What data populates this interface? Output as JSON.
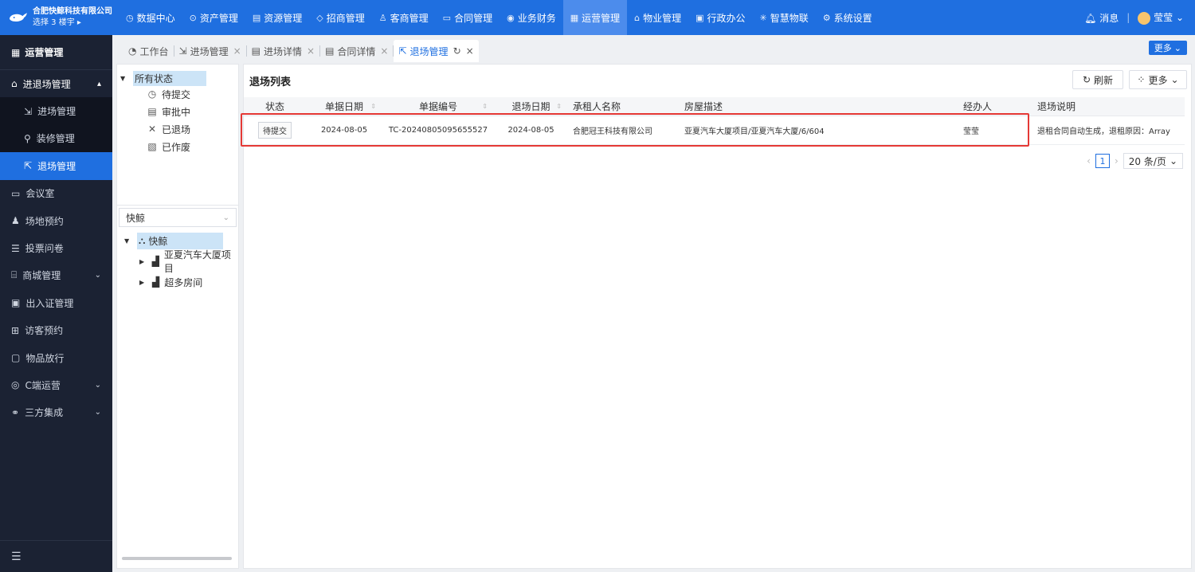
{
  "brand": {
    "name": "合肥快鲸科技有限公司",
    "sub": "选择 3 楼宇 ▸"
  },
  "nav": [
    {
      "label": "数据中心",
      "icon": "◷"
    },
    {
      "label": "资产管理",
      "icon": "⊙"
    },
    {
      "label": "资源管理",
      "icon": "▤"
    },
    {
      "label": "招商管理",
      "icon": "◇"
    },
    {
      "label": "客商管理",
      "icon": "♙"
    },
    {
      "label": "合同管理",
      "icon": "▭"
    },
    {
      "label": "业务财务",
      "icon": "◉"
    },
    {
      "label": "运营管理",
      "icon": "▦"
    },
    {
      "label": "物业管理",
      "icon": "⌂"
    },
    {
      "label": "行政办公",
      "icon": "▣"
    },
    {
      "label": "智慧物联",
      "icon": "✳"
    },
    {
      "label": "系统设置",
      "icon": "⚙"
    }
  ],
  "top_right": {
    "messages": "消息",
    "user": "莹莹"
  },
  "sidebar": {
    "header": "运营管理",
    "group_open": "进退场管理",
    "sub_items": [
      "进场管理",
      "装修管理",
      "退场管理"
    ],
    "items": [
      "会议室",
      "场地预约",
      "投票问卷",
      "商城管理",
      "出入证管理",
      "访客预约",
      "物品放行",
      "C端运营",
      "三方集成"
    ]
  },
  "tabs": [
    "工作台",
    "进场管理",
    "进场详情",
    "合同详情",
    "退场管理"
  ],
  "tabs_more": "更多",
  "status_tree": {
    "root": "所有状态",
    "children": [
      "待提交",
      "审批中",
      "已退场",
      "已作废"
    ]
  },
  "org_select": "快鲸",
  "org_tree": {
    "root": "快鲸",
    "children": [
      "亚夏汽车大厦项目",
      "超多房间"
    ]
  },
  "main": {
    "title": "退场列表",
    "refresh": "刷新",
    "more": "更多",
    "columns": [
      "状态",
      "单据日期",
      "单据编号",
      "退场日期",
      "承租人名称",
      "房屋描述",
      "经办人",
      "退场说明"
    ],
    "rows": [
      {
        "status": "待提交",
        "doc_date": "2024-08-05",
        "doc_no": "TC-20240805095655527",
        "exit_date": "2024-08-05",
        "tenant": "合肥冠王科技有限公司",
        "room": "亚夏汽车大厦项目/亚夏汽车大厦/6/604",
        "handler": "莹莹",
        "note": "退租合同自动生成，退租原因：Array"
      }
    ],
    "pager": {
      "page": "1",
      "size": "20 条/页"
    }
  }
}
